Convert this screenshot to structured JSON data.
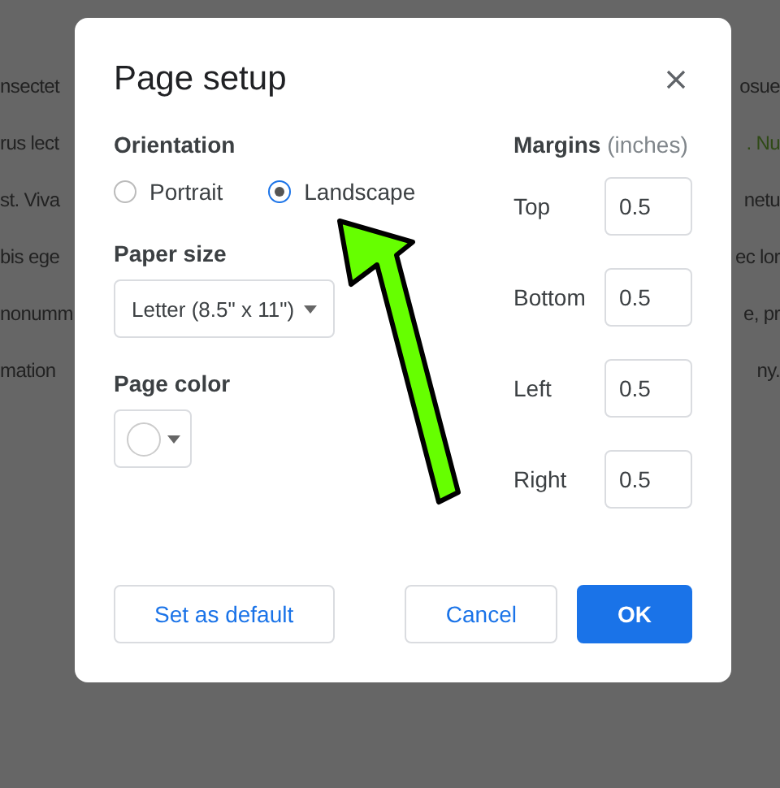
{
  "background_lines": [
    {
      "left": "nsectet",
      "right": "osue",
      "right_highlighted": false
    },
    {
      "left": "rus lect",
      "right": ". Nu",
      "right_highlighted": true
    },
    {
      "left": "st. Viva",
      "right": "netu",
      "right_highlighted": false
    },
    {
      "left": "bis ege",
      "right": "ec lor",
      "right_highlighted": false
    },
    {
      "left": "nonumm",
      "right": "e, pr",
      "right_highlighted": false
    },
    {
      "left": "mation",
      "right": "ny.",
      "right_highlighted": false
    }
  ],
  "dialog": {
    "title": "Page setup",
    "orientation": {
      "label": "Orientation",
      "options": [
        {
          "label": "Portrait",
          "selected": false
        },
        {
          "label": "Landscape",
          "selected": true
        }
      ]
    },
    "paper_size": {
      "label": "Paper size",
      "value": "Letter (8.5\" x 11\")"
    },
    "page_color": {
      "label": "Page color"
    },
    "margins": {
      "label": "Margins",
      "unit": "(inches)",
      "fields": [
        {
          "label": "Top",
          "value": "0.5"
        },
        {
          "label": "Bottom",
          "value": "0.5"
        },
        {
          "label": "Left",
          "value": "0.5"
        },
        {
          "label": "Right",
          "value": "0.5"
        }
      ]
    },
    "buttons": [
      {
        "label": "Set as default",
        "kind": "outline"
      },
      {
        "label": "Cancel",
        "kind": "outline"
      },
      {
        "label": "OK",
        "kind": "primary"
      }
    ]
  }
}
